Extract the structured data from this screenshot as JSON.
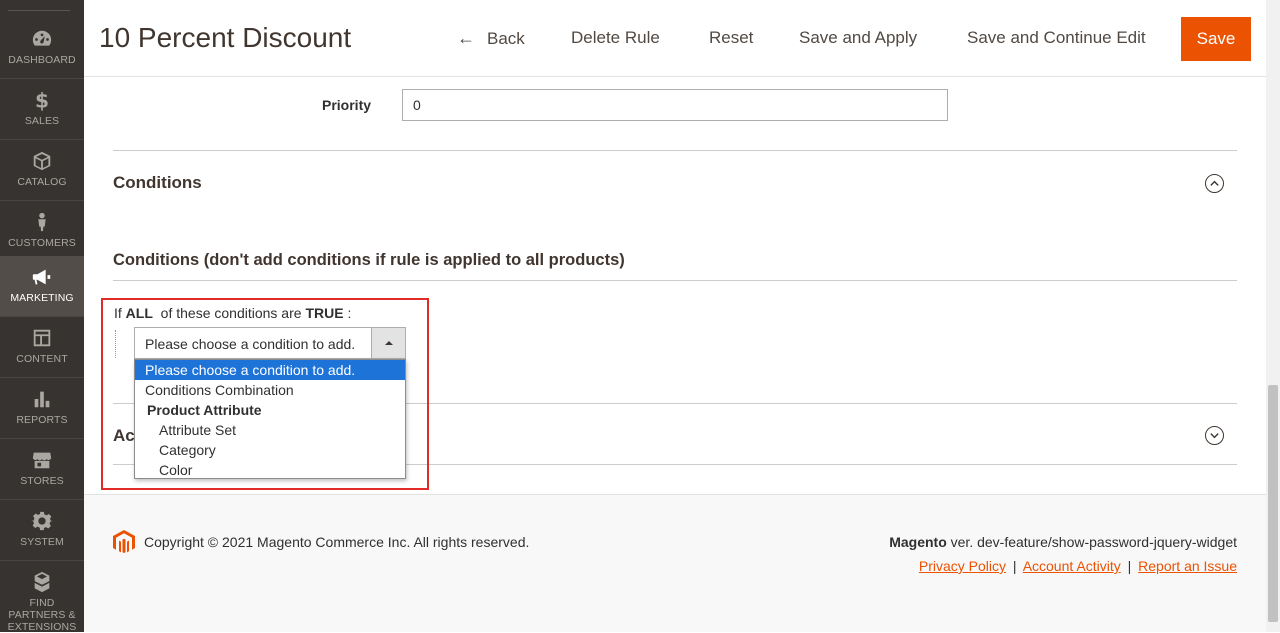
{
  "sidebar": {
    "items": [
      {
        "label": "DASHBOARD",
        "icon": "dashboard-icon"
      },
      {
        "label": "SALES",
        "icon": "dollar-icon"
      },
      {
        "label": "CATALOG",
        "icon": "cube-icon"
      },
      {
        "label": "CUSTOMERS",
        "icon": "person-icon"
      },
      {
        "label": "MARKETING",
        "icon": "megaphone-icon",
        "active": true
      },
      {
        "label": "CONTENT",
        "icon": "layout-icon"
      },
      {
        "label": "REPORTS",
        "icon": "bar-chart-icon"
      },
      {
        "label": "STORES",
        "icon": "store-icon"
      },
      {
        "label": "SYSTEM",
        "icon": "gear-icon"
      },
      {
        "label": "FIND PARTNERS & EXTENSIONS",
        "icon": "boxes-icon"
      }
    ]
  },
  "header": {
    "title": "10 Percent Discount",
    "back_label": "Back",
    "delete_label": "Delete Rule",
    "reset_label": "Reset",
    "save_apply_label": "Save and Apply",
    "save_continue_label": "Save and Continue Edit",
    "save_label": "Save"
  },
  "form": {
    "priority_label": "Priority",
    "priority_value": "0"
  },
  "conditions": {
    "section_title": "Conditions",
    "heading": "Conditions (don't add conditions if rule is applied to all products)",
    "line_prefix": "If",
    "aggregator": "ALL",
    "line_middle": "of these conditions are",
    "value": "TRUE",
    "line_suffix": ":",
    "select_value": "Please choose a condition to add.",
    "options": [
      {
        "label": "Please choose a condition to add.",
        "selected": true
      },
      {
        "label": "Conditions Combination"
      },
      {
        "label": "Product Attribute",
        "group": true
      },
      {
        "label": "Attribute Set",
        "sub": true
      },
      {
        "label": "Category",
        "sub": true
      },
      {
        "label": "Color",
        "sub": true
      }
    ]
  },
  "actions": {
    "section_title_partial": "Ac"
  },
  "footer": {
    "copyright": "Copyright © 2021 Magento Commerce Inc. All rights reserved.",
    "brand": "Magento",
    "version": " ver. dev-feature/show-password-jquery-widget",
    "privacy_label": "Privacy Policy",
    "activity_label": "Account Activity",
    "report_label": "Report an Issue",
    "separator": "|"
  },
  "colors": {
    "accent": "#eb5202",
    "sidebar_bg": "#373330",
    "highlight_red": "#e02b27",
    "selected_option": "#1e73d8"
  }
}
